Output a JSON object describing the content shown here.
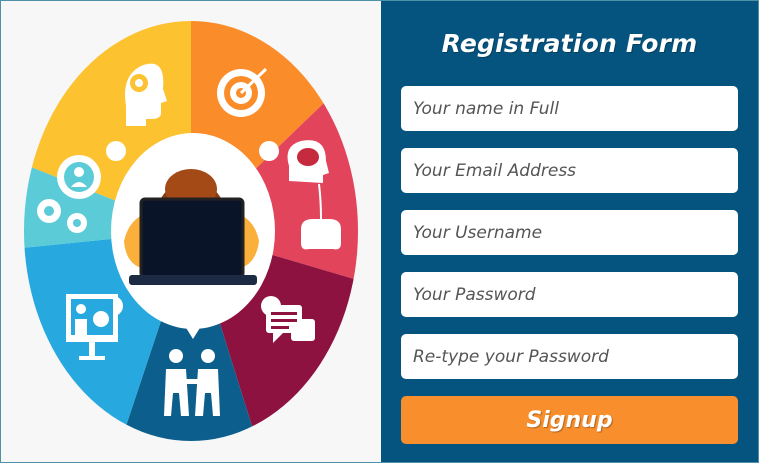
{
  "form": {
    "title": "Registration Form",
    "fields": [
      {
        "name": "full-name",
        "placeholder": "Your name in Full",
        "value": ""
      },
      {
        "name": "email",
        "placeholder": "Your Email Address",
        "value": ""
      },
      {
        "name": "username",
        "placeholder": "Your Username",
        "value": ""
      },
      {
        "name": "password",
        "placeholder": "Your Password",
        "value": ""
      },
      {
        "name": "retype-password",
        "placeholder": "Re-type your Password",
        "value": ""
      }
    ],
    "submit_label": "Signup"
  },
  "illustration": {
    "segments": [
      {
        "icon": "gear-head-icon",
        "color": "#fdc22f"
      },
      {
        "icon": "target-icon",
        "color": "#fb8c2a"
      },
      {
        "icon": "brain-gamepad-icon",
        "color": "#e2445c"
      },
      {
        "icon": "chat-bubbles-icon",
        "color": "#8e1240"
      },
      {
        "icon": "handshake-icon",
        "color": "#0c5f8d"
      },
      {
        "icon": "presentation-icon",
        "color": "#27a9df"
      },
      {
        "icon": "team-gears-icon",
        "color": "#5bcbd8"
      }
    ],
    "center_icon": "person-laptop-icon"
  },
  "colors": {
    "panel": "#05547f",
    "button": "#f88f2c",
    "background": "#f7f7f8"
  }
}
